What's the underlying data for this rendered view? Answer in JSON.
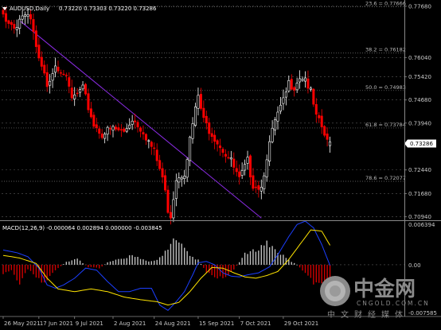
{
  "chart_data": [
    {
      "type": "candlestick",
      "symbol": "AUDUSD,Daily",
      "ohlc_label": "0.73220 0.73303 0.73220 0.73286",
      "current_price": "0.73286",
      "ylim": [
        0.7083,
        0.7788
      ],
      "yticks": [
        "0.77680",
        "0.76040",
        "0.75420",
        "0.74680",
        "0.73940",
        "0.72440",
        "0.71680",
        "0.70940"
      ],
      "fib_levels": [
        {
          "label": "23.6 = 0.77666",
          "value": 0.77666
        },
        {
          "label": "38.2 = 0.76182",
          "value": 0.76182
        },
        {
          "label": "50.0 = 0.74983",
          "value": 0.74983
        },
        {
          "label": "61.8 = 0.73784",
          "value": 0.73784
        },
        {
          "label": "78.6 = 0.72077",
          "value": 0.72077
        }
      ],
      "trendline": [
        {
          "bar": 6,
          "price": 0.7722
        },
        {
          "bar": 94,
          "price": 0.709
        }
      ],
      "close_anchors": [
        [
          0,
          0.774
        ],
        [
          4,
          0.77
        ],
        [
          7,
          0.774
        ],
        [
          10,
          0.772
        ],
        [
          13,
          0.759
        ],
        [
          16,
          0.752
        ],
        [
          19,
          0.7585
        ],
        [
          22,
          0.756
        ],
        [
          25,
          0.747
        ],
        [
          29,
          0.75
        ],
        [
          33,
          0.739
        ],
        [
          36,
          0.736
        ],
        [
          40,
          0.7375
        ],
        [
          44,
          0.7365
        ],
        [
          47,
          0.741
        ],
        [
          51,
          0.737
        ],
        [
          55,
          0.73
        ],
        [
          58,
          0.722
        ],
        [
          60,
          0.712
        ],
        [
          61,
          0.71
        ],
        [
          63,
          0.722
        ],
        [
          66,
          0.724
        ],
        [
          69,
          0.739
        ],
        [
          71,
          0.748
        ],
        [
          73,
          0.74
        ],
        [
          77,
          0.735
        ],
        [
          80,
          0.731
        ],
        [
          83,
          0.727
        ],
        [
          86,
          0.721
        ],
        [
          89,
          0.727
        ],
        [
          91,
          0.72
        ],
        [
          94,
          0.719
        ],
        [
          96,
          0.729
        ],
        [
          99,
          0.74
        ],
        [
          102,
          0.746
        ],
        [
          104,
          0.752
        ],
        [
          106,
          0.7515
        ],
        [
          108,
          0.7545
        ],
        [
          110,
          0.754
        ],
        [
          112,
          0.749
        ],
        [
          114,
          0.741
        ],
        [
          116,
          0.738
        ],
        [
          118,
          0.733
        ],
        [
          119,
          0.7329
        ]
      ]
    },
    {
      "type": "macd",
      "label": "MACD(12,26,9) -0.000064 0.002894 0.000000 -0.003845",
      "yticks": [
        "0.006394",
        "0.00",
        "-0.007585"
      ],
      "ylim": [
        -0.007585,
        0.006394
      ],
      "macd_anchors": [
        [
          0,
          0.0022
        ],
        [
          5,
          0.0018
        ],
        [
          9,
          0.0012
        ],
        [
          13,
          -0.0005
        ],
        [
          16,
          -0.003
        ],
        [
          19,
          -0.0035
        ],
        [
          22,
          -0.003
        ],
        [
          26,
          -0.002
        ],
        [
          30,
          -0.0005
        ],
        [
          34,
          -0.0008
        ],
        [
          38,
          -0.0025
        ],
        [
          42,
          -0.004
        ],
        [
          46,
          -0.004
        ],
        [
          50,
          -0.0035
        ],
        [
          54,
          -0.0035
        ],
        [
          57,
          -0.006
        ],
        [
          60,
          -0.0068
        ],
        [
          63,
          -0.0055
        ],
        [
          66,
          -0.004
        ],
        [
          69,
          -0.0015
        ],
        [
          71,
          0.0003
        ],
        [
          74,
          0.0005
        ],
        [
          77,
          0.0
        ],
        [
          80,
          -0.0012
        ],
        [
          83,
          -0.0017
        ],
        [
          86,
          -0.0018
        ],
        [
          89,
          -0.0015
        ],
        [
          93,
          -0.0012
        ],
        [
          97,
          -0.0003
        ],
        [
          100,
          0.0015
        ],
        [
          104,
          0.0042
        ],
        [
          107,
          0.006
        ],
        [
          110,
          0.0065
        ],
        [
          113,
          0.0055
        ],
        [
          116,
          0.003
        ],
        [
          119,
          -0.0001
        ]
      ],
      "signal_anchors": [
        [
          0,
          0.0014
        ],
        [
          6,
          0.001
        ],
        [
          12,
          0.0002
        ],
        [
          16,
          -0.002
        ],
        [
          20,
          -0.0036
        ],
        [
          26,
          -0.004
        ],
        [
          32,
          -0.0036
        ],
        [
          38,
          -0.004
        ],
        [
          44,
          -0.0048
        ],
        [
          50,
          -0.0052
        ],
        [
          56,
          -0.0055
        ],
        [
          60,
          -0.006
        ],
        [
          64,
          -0.0056
        ],
        [
          68,
          -0.004
        ],
        [
          72,
          -0.002
        ],
        [
          76,
          -0.0004
        ],
        [
          80,
          -0.0005
        ],
        [
          84,
          -0.0012
        ],
        [
          88,
          -0.0018
        ],
        [
          92,
          -0.002
        ],
        [
          96,
          -0.0016
        ],
        [
          100,
          -0.001
        ],
        [
          104,
          0.0008
        ],
        [
          108,
          0.003
        ],
        [
          112,
          0.0052
        ],
        [
          116,
          0.005
        ],
        [
          119,
          0.0029
        ]
      ],
      "hist_anchors": [
        [
          0,
          -0.0015
        ],
        [
          3,
          -0.001
        ],
        [
          6,
          -0.003
        ],
        [
          9,
          -0.0008
        ],
        [
          12,
          -0.002
        ],
        [
          15,
          -0.0032
        ],
        [
          19,
          -0.001
        ],
        [
          23,
          0.0005
        ],
        [
          27,
          0.001
        ],
        [
          31,
          -0.0004
        ],
        [
          35,
          -0.0006
        ],
        [
          38,
          0.0004
        ],
        [
          41,
          0.0008
        ],
        [
          44,
          0.001
        ],
        [
          47,
          0.0018
        ],
        [
          50,
          0.001
        ],
        [
          53,
          0.0005
        ],
        [
          56,
          0.0008
        ],
        [
          59,
          0.0022
        ],
        [
          62,
          0.0042
        ],
        [
          65,
          0.0032
        ],
        [
          68,
          0.0015
        ],
        [
          71,
          0.0008
        ],
        [
          74,
          -0.0012
        ],
        [
          77,
          -0.002
        ],
        [
          80,
          -0.0022
        ],
        [
          84,
          -0.0008
        ],
        [
          88,
          0.0018
        ],
        [
          92,
          0.0025
        ],
        [
          96,
          0.0038
        ],
        [
          100,
          0.0022
        ],
        [
          104,
          0.0008
        ],
        [
          107,
          0.0
        ],
        [
          110,
          -0.0015
        ],
        [
          113,
          -0.003
        ],
        [
          116,
          -0.0036
        ],
        [
          119,
          -0.0038
        ]
      ]
    }
  ],
  "x_labels": [
    {
      "text": "26 May 2021",
      "bar": 0
    },
    {
      "text": "17 Jun 2021",
      "bar": 13
    },
    {
      "text": "9 Jul 2021",
      "bar": 26
    },
    {
      "text": "2 Aug 2021",
      "bar": 40
    },
    {
      "text": "24 Aug 2021",
      "bar": 55
    },
    {
      "text": "15 Sep 2021",
      "bar": 71
    },
    {
      "text": "7 Oct 2021",
      "bar": 86
    },
    {
      "text": "29 Oct 2021",
      "bar": 102
    }
  ],
  "colors": {
    "background": "#000000",
    "grid": "#5a5a5a",
    "bull_fill": "#000000",
    "bull_outline": "#ffffff",
    "bear_fill": "#ff0000",
    "bear_outline": "#ff0000",
    "trendline": "#8a2be2",
    "hist_up": "#c0c0c0",
    "hist_down": "#d00000",
    "macd_line": "#1c3fff",
    "signal_line": "#ffe400",
    "price_box_bg": "#ffffff",
    "watermark": "#8a8a8a"
  },
  "watermark": {
    "cn": "中金网",
    "domain": "CNGOLD.COM.CN",
    "slogan": "中文财经媒体"
  }
}
